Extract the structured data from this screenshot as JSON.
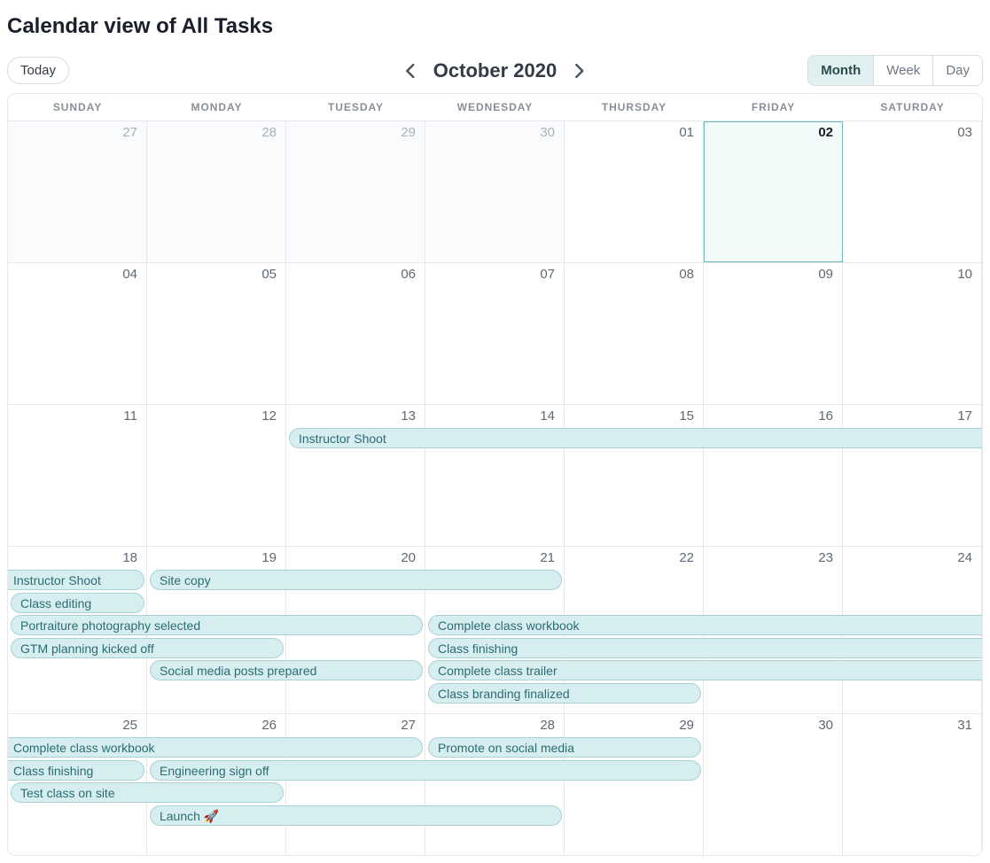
{
  "title": "Calendar view of All Tasks",
  "toolbar": {
    "today_label": "Today",
    "month_label": "October 2020",
    "views": {
      "month": "Month",
      "week": "Week",
      "day": "Day"
    },
    "active_view": "month"
  },
  "days_of_week": [
    "SUNDAY",
    "MONDAY",
    "TUESDAY",
    "WEDNESDAY",
    "THURSDAY",
    "FRIDAY",
    "SATURDAY"
  ],
  "today_index": {
    "week": 0,
    "day": 5
  },
  "weeks": [
    {
      "days": [
        {
          "num": "27",
          "other": true
        },
        {
          "num": "28",
          "other": true
        },
        {
          "num": "29",
          "other": true
        },
        {
          "num": "30",
          "other": true
        },
        {
          "num": "01"
        },
        {
          "num": "02",
          "today": true
        },
        {
          "num": "03"
        }
      ],
      "events": []
    },
    {
      "days": [
        {
          "num": "04"
        },
        {
          "num": "05"
        },
        {
          "num": "06"
        },
        {
          "num": "07"
        },
        {
          "num": "08"
        },
        {
          "num": "09"
        },
        {
          "num": "10"
        }
      ],
      "events": []
    },
    {
      "days": [
        {
          "num": "11"
        },
        {
          "num": "12"
        },
        {
          "num": "13"
        },
        {
          "num": "14"
        },
        {
          "num": "15"
        },
        {
          "num": "16"
        },
        {
          "num": "17"
        }
      ],
      "events": [
        {
          "label": "Instructor Shoot",
          "start": 2,
          "span": 5,
          "row": 0,
          "cont_right": true
        }
      ]
    },
    {
      "days": [
        {
          "num": "18"
        },
        {
          "num": "19"
        },
        {
          "num": "20"
        },
        {
          "num": "21"
        },
        {
          "num": "22"
        },
        {
          "num": "23"
        },
        {
          "num": "24"
        }
      ],
      "events": [
        {
          "label": "Instructor Shoot",
          "start": 0,
          "span": 1,
          "row": 0,
          "cont_left": true
        },
        {
          "label": "Site copy",
          "start": 1,
          "span": 3,
          "row": 0
        },
        {
          "label": "Class editing",
          "start": 0,
          "span": 1,
          "row": 1
        },
        {
          "label": "Portraiture photography selected",
          "start": 0,
          "span": 3,
          "row": 2
        },
        {
          "label": "Complete class workbook",
          "start": 3,
          "span": 4,
          "row": 2,
          "cont_right": true
        },
        {
          "label": "GTM planning kicked off",
          "start": 0,
          "span": 2,
          "row": 3
        },
        {
          "label": "Class finishing",
          "start": 3,
          "span": 4,
          "row": 3,
          "cont_right": true
        },
        {
          "label": "Social media posts prepared",
          "start": 1,
          "span": 2,
          "row": 4
        },
        {
          "label": "Complete class trailer",
          "start": 3,
          "span": 4,
          "row": 4,
          "cont_right": true
        },
        {
          "label": "Class branding finalized",
          "start": 3,
          "span": 2,
          "row": 5
        }
      ]
    },
    {
      "days": [
        {
          "num": "25"
        },
        {
          "num": "26"
        },
        {
          "num": "27"
        },
        {
          "num": "28"
        },
        {
          "num": "29"
        },
        {
          "num": "30"
        },
        {
          "num": "31"
        }
      ],
      "events": [
        {
          "label": "Complete class workbook",
          "start": 0,
          "span": 3,
          "row": 0,
          "cont_left": true
        },
        {
          "label": "Promote on social media",
          "start": 3,
          "span": 2,
          "row": 0
        },
        {
          "label": "Class finishing",
          "start": 0,
          "span": 1,
          "row": 1,
          "cont_left": true
        },
        {
          "label": "Engineering sign off",
          "start": 1,
          "span": 4,
          "row": 1
        },
        {
          "label": "Test class on site",
          "start": 0,
          "span": 2,
          "row": 2
        },
        {
          "label": "Launch 🚀",
          "start": 1,
          "span": 3,
          "row": 3
        }
      ]
    }
  ]
}
